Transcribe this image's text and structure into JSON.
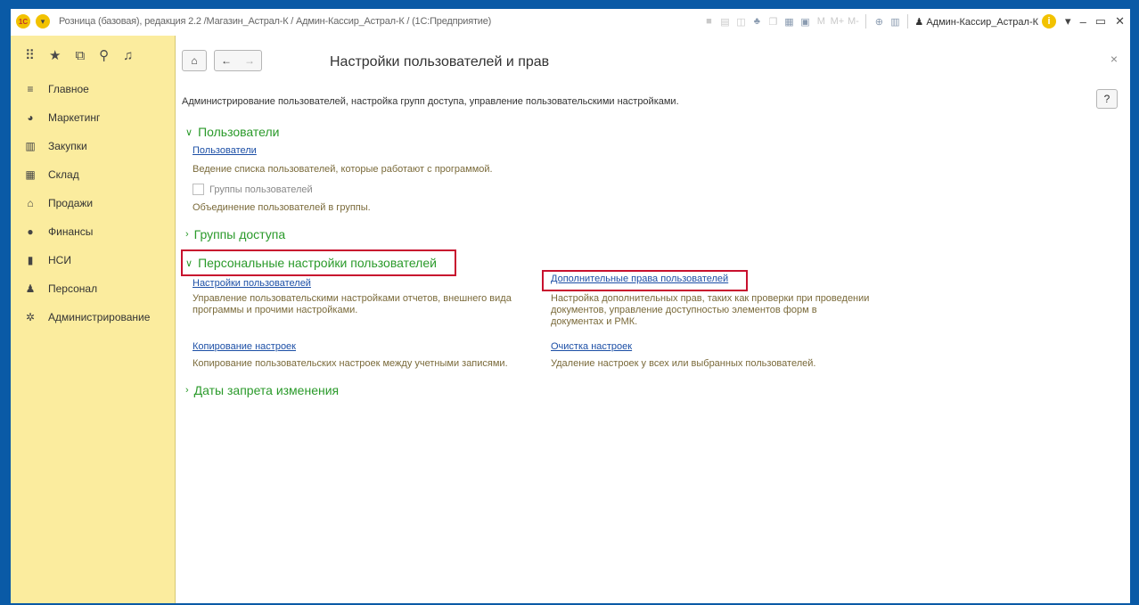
{
  "window": {
    "title": "Розница (базовая), редакция 2.2 /Магазин_Астрал-К / Админ-Кассир_Астрал-К / (1С:Предприятие)",
    "logo_text": "1С",
    "user": "Админ-Кассир_Астрал-К",
    "memory_buttons": [
      "M",
      "M+",
      "M-"
    ]
  },
  "sidebar": {
    "items": [
      {
        "label": "Главное",
        "icon": "menu-lines-icon"
      },
      {
        "label": "Маркетинг",
        "icon": "marketing-icon"
      },
      {
        "label": "Закупки",
        "icon": "purchases-icon"
      },
      {
        "label": "Склад",
        "icon": "warehouse-icon"
      },
      {
        "label": "Продажи",
        "icon": "basket-icon"
      },
      {
        "label": "Финансы",
        "icon": "finance-icon"
      },
      {
        "label": "НСИ",
        "icon": "reference-icon"
      },
      {
        "label": "Персонал",
        "icon": "person-icon"
      },
      {
        "label": "Администрирование",
        "icon": "gear-icon"
      }
    ]
  },
  "page": {
    "title": "Настройки пользователей и прав",
    "description": "Администрирование пользователей, настройка групп доступа, управление пользовательскими настройками.",
    "help_label": "?",
    "sections": {
      "users": {
        "title": "Пользователи",
        "link": "Пользователи",
        "link_note": "Ведение списка пользователей, которые работают с программой.",
        "checkbox_label": "Группы пользователей",
        "checkbox_note": "Объединение пользователей в группы."
      },
      "access_groups": {
        "title": "Группы доступа"
      },
      "personal": {
        "title": "Персональные настройки пользователей",
        "user_settings": "Настройки пользователей",
        "user_settings_note": "Управление пользовательскими настройками отчетов, внешнего вида программы и прочими настройками.",
        "extra_rights": "Дополнительные права пользователей",
        "extra_rights_note": "Настройка дополнительных прав, таких как проверки при проведении документов, управление доступностью элементов форм в документах и РМК.",
        "copy_settings": "Копирование настроек",
        "copy_settings_note": "Копирование пользовательских настроек между учетными записями.",
        "clear_settings": "Очистка настроек",
        "clear_settings_note": "Удаление настроек у всех или выбранных пользователей."
      },
      "dates": {
        "title": "Даты запрета изменения"
      }
    }
  },
  "colors": {
    "frame": "#0a5aa6",
    "sidebar_bg": "#fbec9e",
    "section_green": "#2a9a2a",
    "link_blue": "#1c4fa6",
    "highlight_red": "#c8102e"
  }
}
